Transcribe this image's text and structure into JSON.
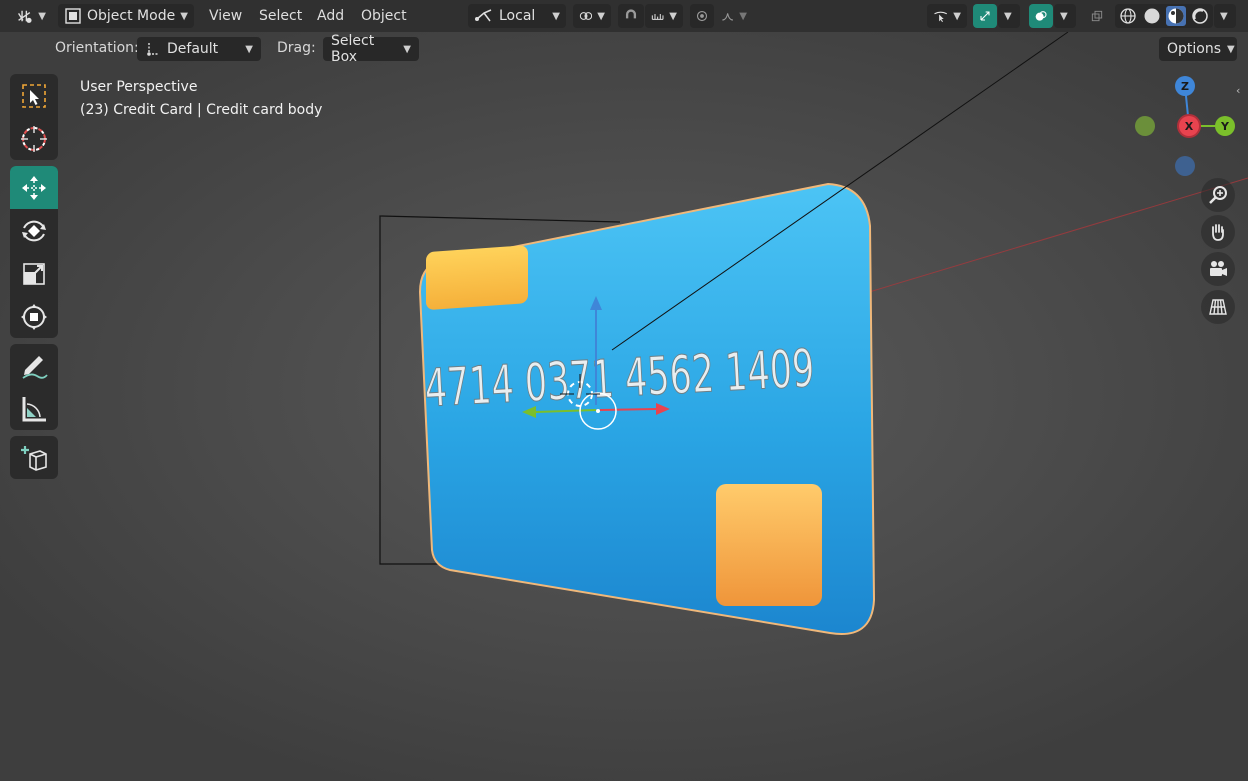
{
  "header": {
    "mode_label": "Object Mode",
    "menu": {
      "view": "View",
      "select": "Select",
      "add": "Add",
      "object": "Object"
    },
    "transform_orientation": "Local"
  },
  "tool_settings": {
    "orientation_label": "Orientation:",
    "orientation_value": "Default",
    "drag_label": "Drag:",
    "drag_value": "Select Box",
    "options_label": "Options"
  },
  "viewport": {
    "view_name": "User Perspective",
    "object_info": "(23) Credit Card | Credit card body"
  },
  "card": {
    "number": "4714 0371 4562 1409"
  },
  "gizmo": {
    "x": "X",
    "y": "Y",
    "z": "Z"
  },
  "colors": {
    "header_bg": "#303030",
    "active_teal": "#1f8a78",
    "card_blue": "#2aa9e6",
    "card_chip": "#f5b942",
    "axis_x": "#e8434f",
    "axis_y": "#7bbf2b",
    "axis_z": "#3f86d8"
  },
  "toolbar": [
    "select-box-tool",
    "cursor-tool",
    "move-tool",
    "rotate-tool",
    "scale-tool",
    "transform-tool",
    "annotate-tool",
    "measure-tool",
    "add-cube-tool"
  ]
}
